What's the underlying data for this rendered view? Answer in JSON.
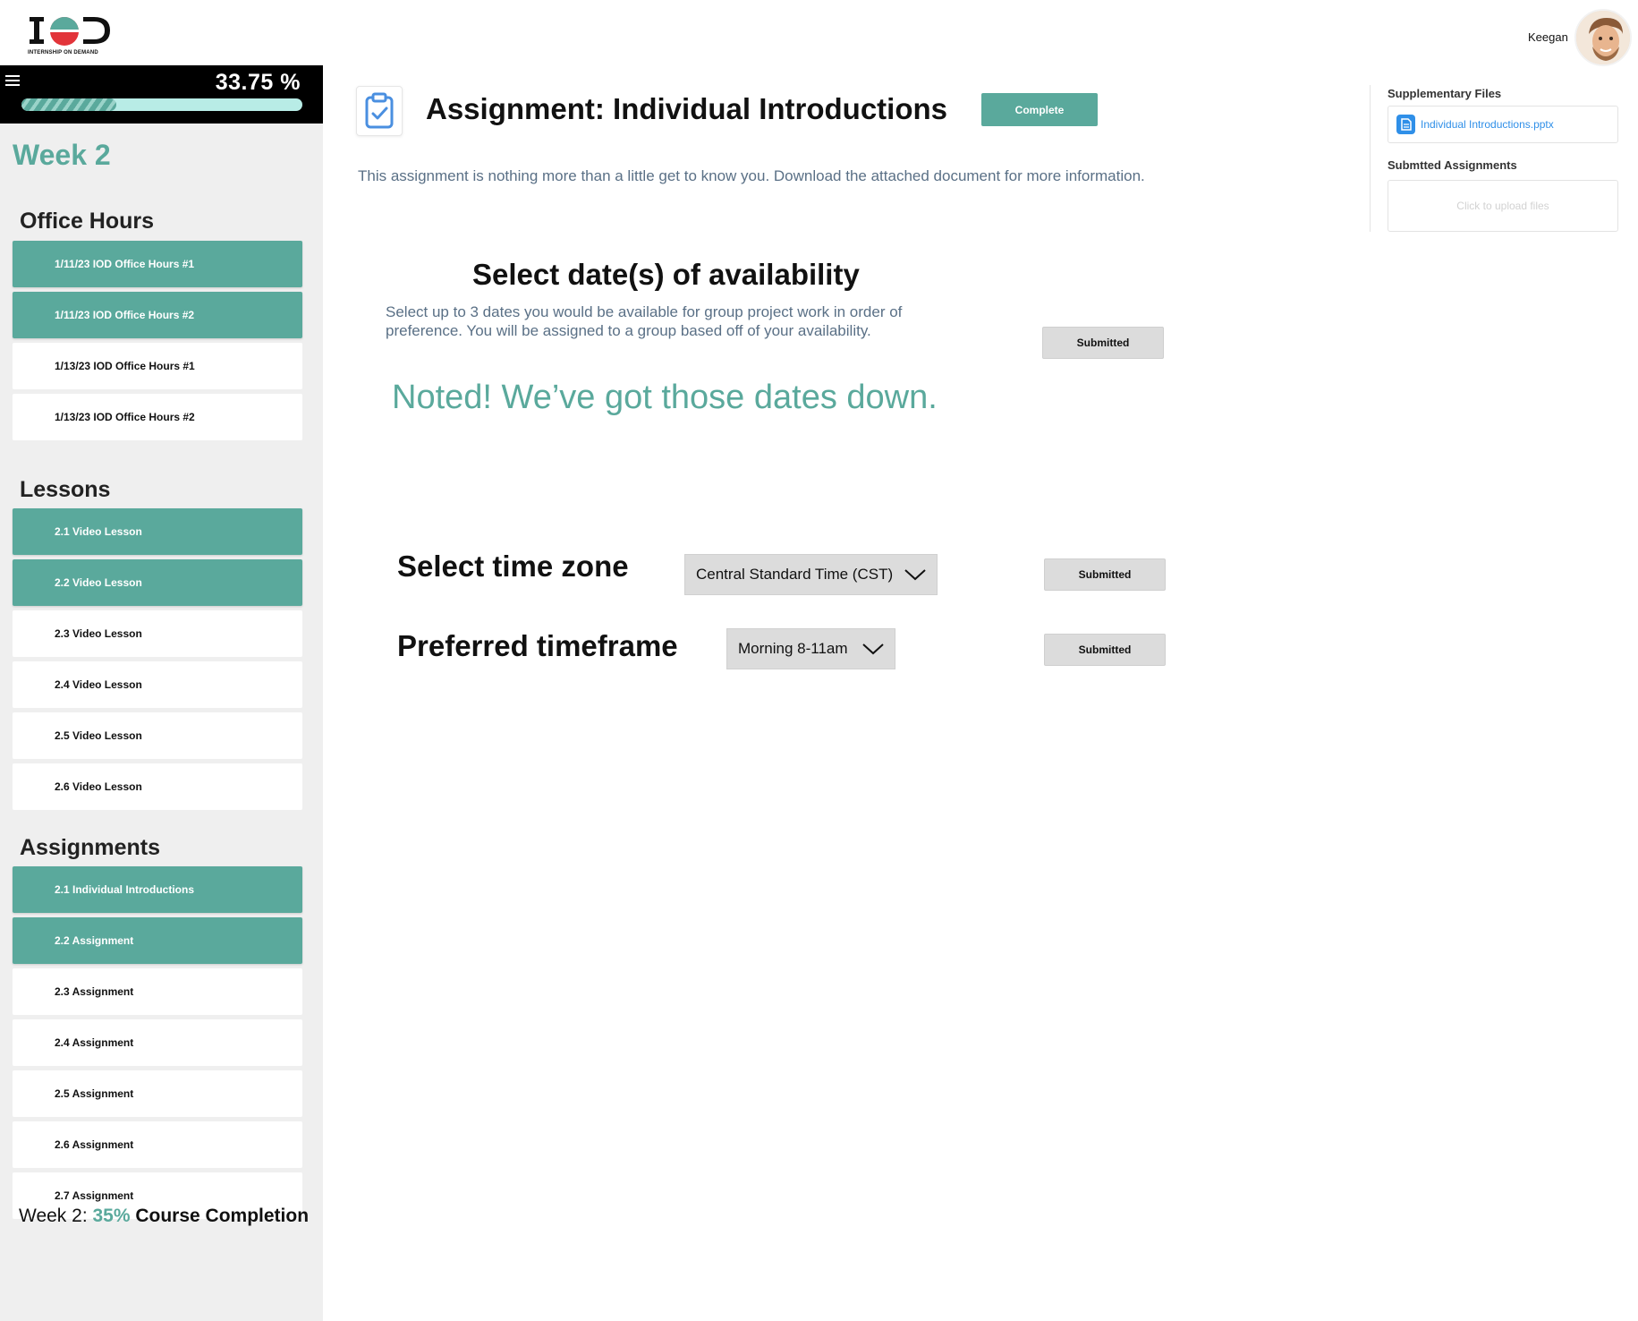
{
  "header": {
    "logo_text": "IOD",
    "logo_subtitle": "INTERNSHIP ON DEMAND",
    "user_name": "Keegan"
  },
  "sidebar": {
    "progress_text": "33.75 %",
    "progress_value": 0.3375,
    "week_title": "Week 2",
    "office_hours_title": "Office Hours",
    "office_hours": [
      {
        "label": "1/11/23 IOD Office Hours #1",
        "active": true
      },
      {
        "label": "1/11/23 IOD Office Hours #2",
        "active": true
      },
      {
        "label": "1/13/23 IOD Office Hours #1",
        "active": false
      },
      {
        "label": "1/13/23 IOD Office Hours #2",
        "active": false
      }
    ],
    "lessons_title": "Lessons",
    "lessons": [
      {
        "label": "2.1 Video Lesson",
        "active": true
      },
      {
        "label": "2.2 Video Lesson",
        "active": true
      },
      {
        "label": "2.3 Video Lesson",
        "active": false
      },
      {
        "label": "2.4 Video Lesson",
        "active": false
      },
      {
        "label": "2.5 Video Lesson",
        "active": false
      },
      {
        "label": "2.6 Video Lesson",
        "active": false
      }
    ],
    "assignments_title": "Assignments",
    "assignments": [
      {
        "label": "2.1 Individual Introductions",
        "active": true
      },
      {
        "label": "2.2 Assignment",
        "active": true
      },
      {
        "label": "2.3 Assignment",
        "active": false
      },
      {
        "label": "2.4 Assignment",
        "active": false
      },
      {
        "label": "2.5 Assignment",
        "active": false
      },
      {
        "label": "2.6 Assignment",
        "active": false
      },
      {
        "label": "2.7 Assignment",
        "active": false
      }
    ],
    "footer": {
      "prefix": "Week 2: ",
      "pct": "35%",
      "suffix": " Course Completion"
    }
  },
  "main": {
    "title": "Assignment: Individual Introductions",
    "complete_label": "Complete",
    "description": "This assignment is nothing more than a little get to know you. Download the attached document for more information.",
    "dates": {
      "title": "Select date(s) of availability",
      "description": "Select up to 3 dates you would be available for group project work in order of preference. You will be assigned to a group based off of your availability.",
      "submitted_label": "Submitted",
      "confirmation": "Noted! We’ve got those dates down."
    },
    "timezone": {
      "label": "Select time zone",
      "selected": "Central Standard Time (CST)",
      "submitted_label": "Submitted"
    },
    "timeframe": {
      "label": "Preferred timeframe",
      "selected": "Morning 8-11am",
      "submitted_label": "Submitted"
    }
  },
  "right_panel": {
    "supplementary_title": "Supplementary Files",
    "file_name": "Individual Introductions.pptx",
    "submitted_title": "Submtted Assignments",
    "upload_placeholder": "Click to upload files"
  },
  "colors": {
    "accent": "#5aa99c",
    "link": "#2f8fe8",
    "muted_text": "#5a7086",
    "sidebar_bg": "#efefef"
  }
}
